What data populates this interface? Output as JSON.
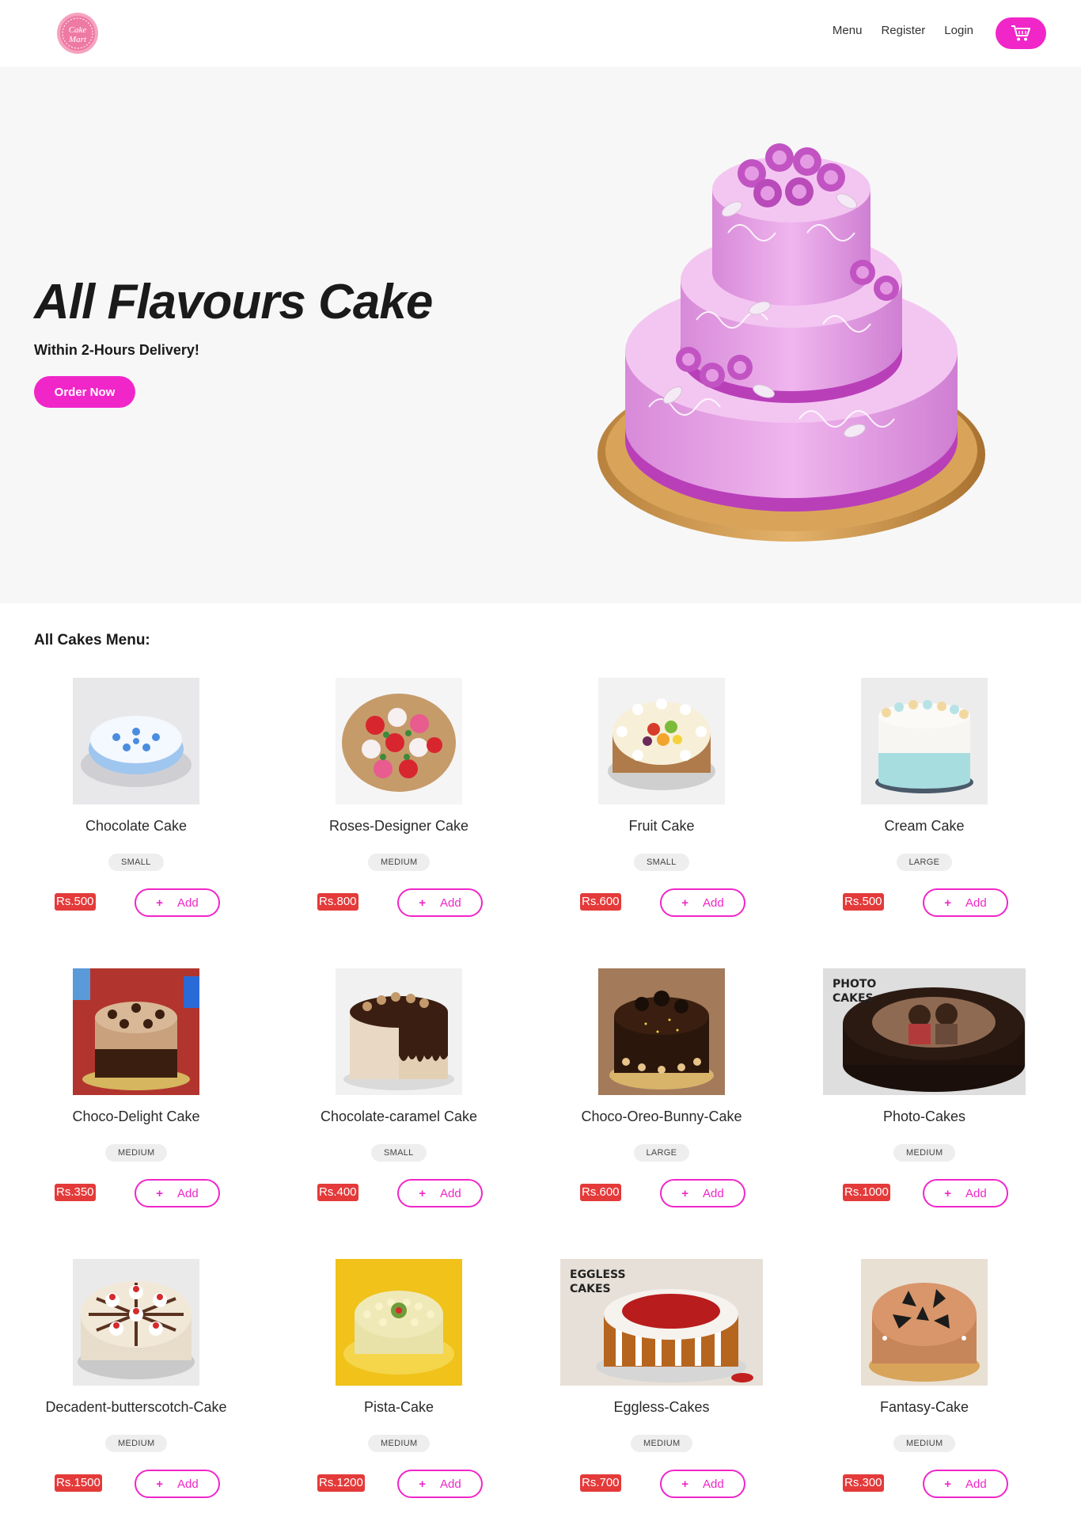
{
  "brand": {
    "logo_text_1": "Cake",
    "logo_text_2": "Mart"
  },
  "nav": {
    "menu": "Menu",
    "register": "Register",
    "login": "Login"
  },
  "colors": {
    "accent": "#f026c9",
    "price": "#e43a3a",
    "hero_bg": "#f7f7f7"
  },
  "hero": {
    "title": "All Flavours Cake",
    "subtitle": "Within 2-Hours Delivery!",
    "cta": "Order Now"
  },
  "menu": {
    "title": "All Cakes Menu:",
    "add_label": "Add",
    "add_icon": "+",
    "items": [
      {
        "name": "Chocolate Cake",
        "size": "SMALL",
        "price": "Rs.500",
        "theme": "blue-white"
      },
      {
        "name": "Roses-Designer Cake",
        "size": "MEDIUM",
        "price": "Rs.800",
        "theme": "roses"
      },
      {
        "name": "Fruit Cake",
        "size": "SMALL",
        "price": "Rs.600",
        "theme": "fruit"
      },
      {
        "name": "Cream Cake",
        "size": "LARGE",
        "price": "Rs.500",
        "theme": "cream"
      },
      {
        "name": "Choco-Delight Cake",
        "size": "MEDIUM",
        "price": "Rs.350",
        "theme": "choco"
      },
      {
        "name": "Chocolate-caramel Cake",
        "size": "SMALL",
        "price": "Rs.400",
        "theme": "caramel"
      },
      {
        "name": "Choco-Oreo-Bunny-Cake",
        "size": "LARGE",
        "price": "Rs.600",
        "theme": "oreo"
      },
      {
        "name": "Photo-Cakes",
        "size": "MEDIUM",
        "price": "Rs.1000",
        "theme": "photo",
        "overlay": "PHOTO\nCAKES"
      },
      {
        "name": "Decadent-butterscotch-Cake",
        "size": "MEDIUM",
        "price": "Rs.1500",
        "theme": "butterscotch"
      },
      {
        "name": "Pista-Cake",
        "size": "MEDIUM",
        "price": "Rs.1200",
        "theme": "pista"
      },
      {
        "name": "Eggless-Cakes",
        "size": "MEDIUM",
        "price": "Rs.700",
        "theme": "eggless",
        "overlay": "EGGLESS\nCAKES"
      },
      {
        "name": "Fantasy-Cake",
        "size": "MEDIUM",
        "price": "Rs.300",
        "theme": "fantasy"
      }
    ]
  }
}
